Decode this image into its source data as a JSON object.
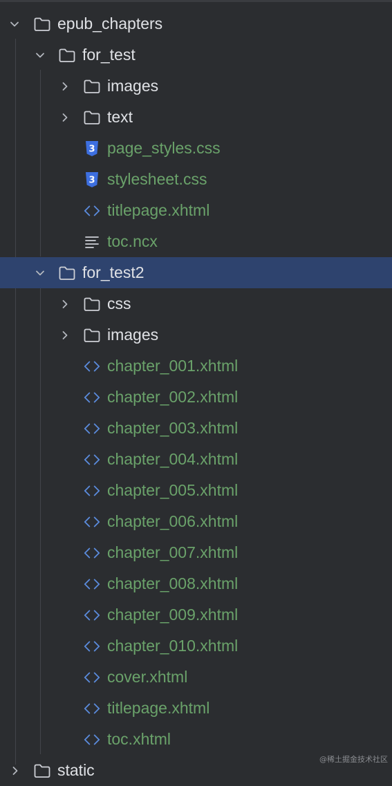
{
  "colors": {
    "background": "#2b2d30",
    "selected_row": "#2e436e",
    "folder_text": "#dfe1e5",
    "file_text": "#6aa26a",
    "css_icon": "#3d6fe0",
    "html_icon": "#5b8bdc"
  },
  "tree": {
    "root": {
      "label": "epub_chapters",
      "icon": "folder-icon",
      "expanded": true
    },
    "for_test": {
      "label": "for_test",
      "icon": "folder-icon",
      "expanded": true,
      "children": [
        {
          "label": "images",
          "type": "folder",
          "icon": "folder-icon"
        },
        {
          "label": "text",
          "type": "folder",
          "icon": "folder-icon"
        },
        {
          "label": "page_styles.css",
          "type": "css",
          "icon": "css-file-icon"
        },
        {
          "label": "stylesheet.css",
          "type": "css",
          "icon": "css-file-icon"
        },
        {
          "label": "titlepage.xhtml",
          "type": "xhtml",
          "icon": "xhtml-file-icon"
        },
        {
          "label": "toc.ncx",
          "type": "text",
          "icon": "text-file-icon"
        }
      ]
    },
    "for_test2": {
      "label": "for_test2",
      "icon": "folder-icon",
      "expanded": true,
      "selected": true,
      "children": [
        {
          "label": "css",
          "type": "folder",
          "icon": "folder-icon"
        },
        {
          "label": "images",
          "type": "folder",
          "icon": "folder-icon"
        },
        {
          "label": "chapter_001.xhtml",
          "type": "xhtml",
          "icon": "xhtml-file-icon"
        },
        {
          "label": "chapter_002.xhtml",
          "type": "xhtml",
          "icon": "xhtml-file-icon"
        },
        {
          "label": "chapter_003.xhtml",
          "type": "xhtml",
          "icon": "xhtml-file-icon"
        },
        {
          "label": "chapter_004.xhtml",
          "type": "xhtml",
          "icon": "xhtml-file-icon"
        },
        {
          "label": "chapter_005.xhtml",
          "type": "xhtml",
          "icon": "xhtml-file-icon"
        },
        {
          "label": "chapter_006.xhtml",
          "type": "xhtml",
          "icon": "xhtml-file-icon"
        },
        {
          "label": "chapter_007.xhtml",
          "type": "xhtml",
          "icon": "xhtml-file-icon"
        },
        {
          "label": "chapter_008.xhtml",
          "type": "xhtml",
          "icon": "xhtml-file-icon"
        },
        {
          "label": "chapter_009.xhtml",
          "type": "xhtml",
          "icon": "xhtml-file-icon"
        },
        {
          "label": "chapter_010.xhtml",
          "type": "xhtml",
          "icon": "xhtml-file-icon"
        },
        {
          "label": "cover.xhtml",
          "type": "xhtml",
          "icon": "xhtml-file-icon"
        },
        {
          "label": "titlepage.xhtml",
          "type": "xhtml",
          "icon": "xhtml-file-icon"
        },
        {
          "label": "toc.xhtml",
          "type": "xhtml",
          "icon": "xhtml-file-icon"
        }
      ]
    },
    "partial_next": {
      "label": "static",
      "icon": "folder-icon"
    }
  },
  "watermark": "@稀土掘金技术社区"
}
